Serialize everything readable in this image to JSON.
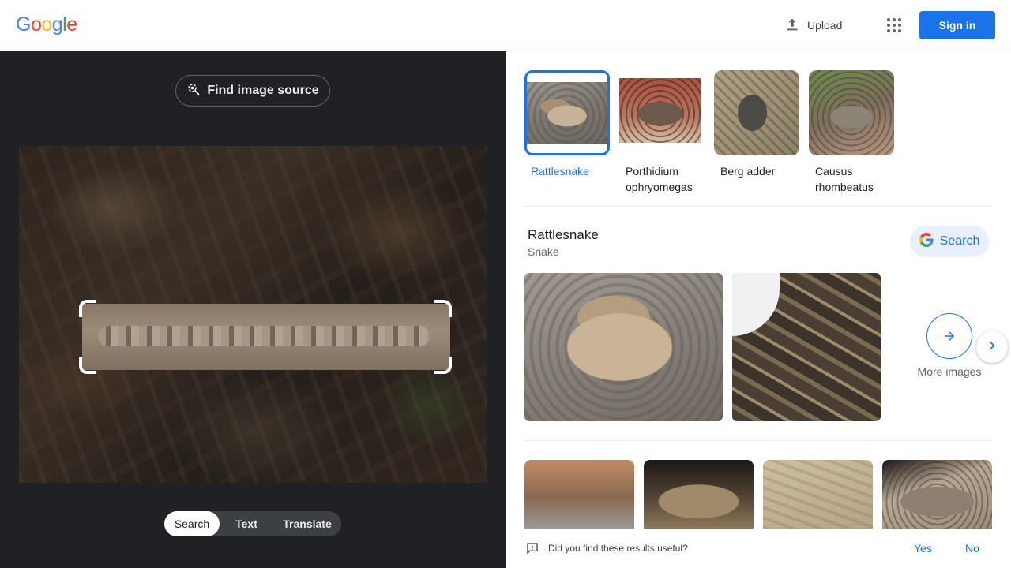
{
  "header": {
    "logo_letters": [
      {
        "ch": "G",
        "color": "#4285F4"
      },
      {
        "ch": "o",
        "color": "#EA4335"
      },
      {
        "ch": "o",
        "color": "#FBBC05"
      },
      {
        "ch": "g",
        "color": "#4285F4"
      },
      {
        "ch": "l",
        "color": "#34A853"
      },
      {
        "ch": "e",
        "color": "#EA4335"
      }
    ],
    "upload_label": "Upload",
    "upload_icon": "upload-icon",
    "apps_icon": "apps-grid-icon",
    "signin_label": "Sign in"
  },
  "left_panel": {
    "find_source_label": "Find image source",
    "find_source_icon": "lens-search-icon",
    "modes": [
      {
        "label": "Search",
        "active": true
      },
      {
        "label": "Text",
        "active": false
      },
      {
        "label": "Translate",
        "active": false
      }
    ]
  },
  "right_panel": {
    "chips": [
      {
        "label": "Rattlesnake",
        "selected": true
      },
      {
        "label": "Porthidium ophryomegas",
        "selected": false
      },
      {
        "label": "Berg adder",
        "selected": false
      },
      {
        "label": "Causus rhombeatus",
        "selected": false
      }
    ],
    "entity": {
      "title": "Rattlesnake",
      "subtitle": "Snake",
      "search_label": "Search"
    },
    "more_images_label": "More images"
  },
  "feedback": {
    "question": "Did you find these results useful?",
    "yes_label": "Yes",
    "no_label": "No"
  },
  "colors": {
    "accent": "#1a73e8",
    "left_bg": "#202124"
  }
}
